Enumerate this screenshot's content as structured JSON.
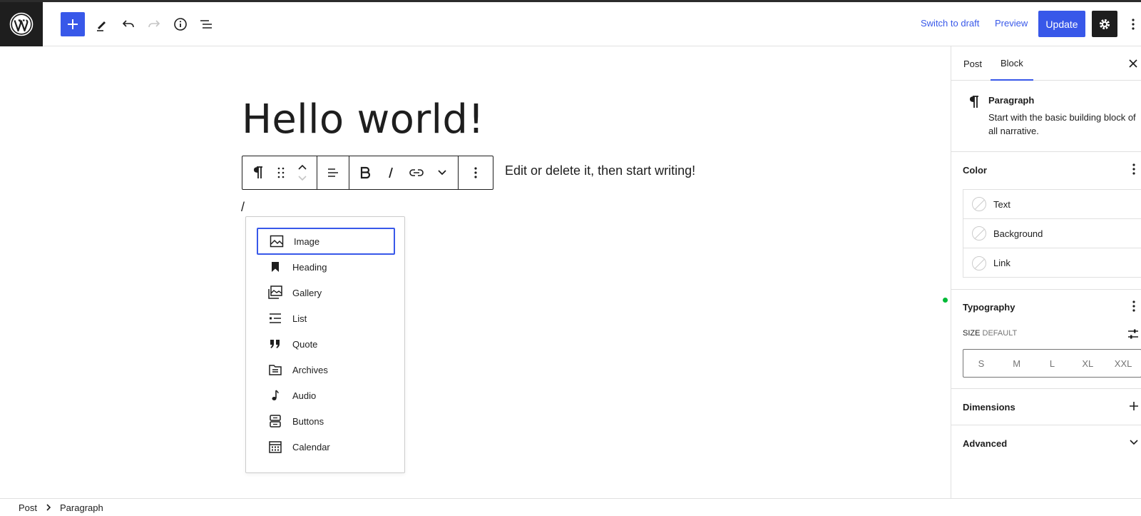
{
  "header": {
    "inserter_icon": "plus-icon",
    "tools_icon": "pencil-icon",
    "undo_icon": "undo-icon",
    "redo_icon": "redo-icon",
    "details_icon": "info-icon",
    "list_view_icon": "list-view-icon",
    "switch_to_draft": "Switch to draft",
    "preview": "Preview",
    "update": "Update"
  },
  "editor": {
    "title": "Hello world!",
    "paragraph_text": "Edit or delete it, then start writing!",
    "slash": "/"
  },
  "slash_menu": {
    "items": [
      {
        "label": "Image",
        "icon": "image-icon"
      },
      {
        "label": "Heading",
        "icon": "bookmark-icon"
      },
      {
        "label": "Gallery",
        "icon": "gallery-icon"
      },
      {
        "label": "List",
        "icon": "list-icon"
      },
      {
        "label": "Quote",
        "icon": "quote-icon"
      },
      {
        "label": "Archives",
        "icon": "archive-icon"
      },
      {
        "label": "Audio",
        "icon": "audio-icon"
      },
      {
        "label": "Buttons",
        "icon": "buttons-icon"
      },
      {
        "label": "Calendar",
        "icon": "calendar-icon"
      }
    ]
  },
  "sidebar": {
    "tabs": [
      {
        "label": "Post"
      },
      {
        "label": "Block"
      }
    ],
    "block_card": {
      "title": "Paragraph",
      "description": "Start with the basic building block of all narrative."
    },
    "color": {
      "title": "Color",
      "items": [
        {
          "label": "Text"
        },
        {
          "label": "Background"
        },
        {
          "label": "Link"
        }
      ]
    },
    "typography": {
      "title": "Typography",
      "size_label": "SIZE",
      "size_default": "DEFAULT",
      "sizes": [
        "S",
        "M",
        "L",
        "XL",
        "XXL"
      ]
    },
    "dimensions": {
      "title": "Dimensions"
    },
    "advanced": {
      "title": "Advanced"
    }
  },
  "footer": {
    "breadcrumb": [
      "Post",
      "Paragraph"
    ]
  },
  "colors": {
    "accent": "#3858e9",
    "dark": "#1e1e1e",
    "status_dot": "#00ba37"
  }
}
